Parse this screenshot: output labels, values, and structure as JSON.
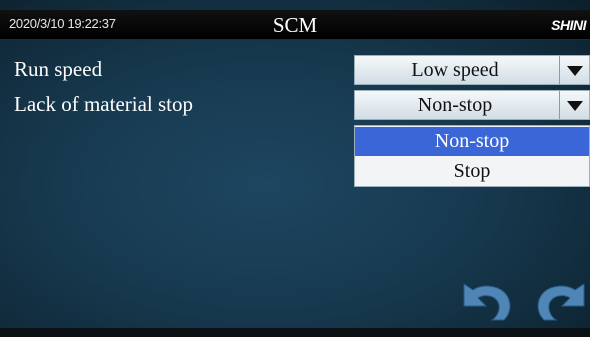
{
  "header": {
    "datetime": "2020/3/10 19:22:37",
    "title": "SCM",
    "logo": "SHINI"
  },
  "settings": [
    {
      "label": "Run speed",
      "value": "Low speed"
    },
    {
      "label": "Lack of material stop",
      "value": "Non-stop"
    }
  ],
  "dropdown_open": {
    "options": [
      "Non-stop",
      "Stop"
    ],
    "selected": "Non-stop"
  },
  "nav": {
    "back_icon": "undo-arrow-icon",
    "forward_icon": "redo-arrow-icon"
  },
  "colors": {
    "header_bg": "#000000",
    "screen_bg": "#173a50",
    "selected_option": "#3a66d8",
    "nav_icon": "#4f86b6"
  }
}
